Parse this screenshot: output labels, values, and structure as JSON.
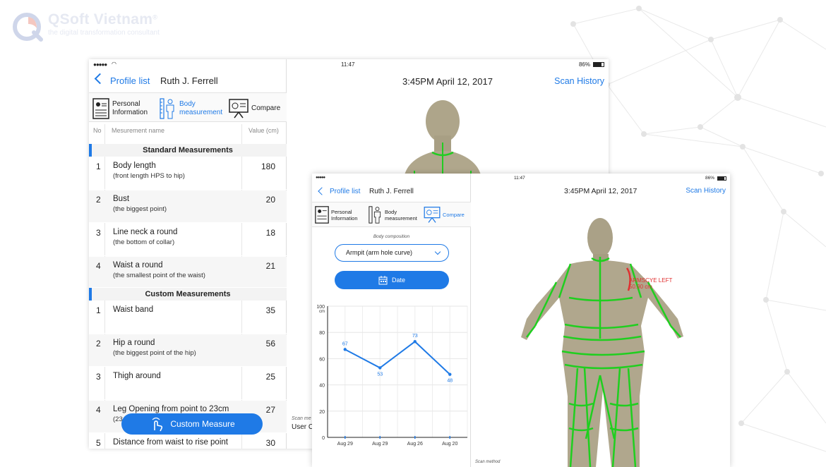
{
  "brand": {
    "name": "QSoft Vietnam",
    "registered": "®",
    "tagline": "the digital transformation consultant"
  },
  "colors": {
    "accent": "#1f7ae6",
    "body_green": "#1fcf1f",
    "label_red": "#e03030"
  },
  "back_tablet": {
    "status": {
      "signal": "●●●●●",
      "time": "11:47",
      "battery": "86%"
    },
    "nav": {
      "back_label": "Profile list",
      "name": "Ruth J. Ferrell"
    },
    "tabs": {
      "personal": "Personal Information",
      "body": "Body measurement",
      "compare": "Compare"
    },
    "columns": {
      "no": "No",
      "name": "Mesurement name",
      "value": "Value (cm)"
    },
    "standard_title": "Standard Measurements",
    "standard": [
      {
        "no": "1",
        "name": "Body length",
        "sub": "(front length HPS to hip)",
        "value": "180"
      },
      {
        "no": "2",
        "name": "Bust",
        "sub": "(the biggest point)",
        "value": "20"
      },
      {
        "no": "3",
        "name": "Line neck a round",
        "sub": "(the bottom of collar)",
        "value": "18"
      },
      {
        "no": "4",
        "name": "Waist a round",
        "sub": "(the smallest point of the waist)",
        "value": "21"
      }
    ],
    "custom_title": "Custom Measurements",
    "custom": [
      {
        "no": "1",
        "name": "Waist band",
        "sub": "",
        "value": "35"
      },
      {
        "no": "2",
        "name": "Hip a round",
        "sub": "(the biggest point of the hip)",
        "value": "56"
      },
      {
        "no": "3",
        "name": "Thigh around",
        "sub": "",
        "value": "25"
      },
      {
        "no": "4",
        "name": "Leg Opening from point to 23cm",
        "sub": "(23",
        "value": "27"
      },
      {
        "no": "5",
        "name": "Distance from waist to rise point",
        "sub": "",
        "value": "30"
      }
    ],
    "custom_measure_button": "Custom Measure",
    "scan_time": "3:45PM April 12, 2017",
    "scan_history": "Scan History",
    "scan_method": "Scan me",
    "user": "User C"
  },
  "front_tablet": {
    "status": {
      "signal": "●●●●●",
      "time": "11:47",
      "battery": "86%"
    },
    "nav": {
      "back_label": "Profile list",
      "name": "Ruth J. Ferrell"
    },
    "tabs": {
      "personal": "Personal Information",
      "body": "Body measurement",
      "compare": "Compare"
    },
    "body_composition_label": "Body composition",
    "select_value": "Armpit (arm hole curve)",
    "date_button": "Date",
    "scan_time": "3:45PM April 12, 2017",
    "scan_history": "Scan History",
    "scan_method": "Scan method",
    "model_label_1": "ARMSCYE LEFT",
    "model_label_2": "50.90 cm"
  },
  "chart_data": {
    "type": "line",
    "title": "",
    "xlabel": "",
    "ylabel": "cm",
    "ylim": [
      0,
      100
    ],
    "yticks": [
      0,
      20,
      40,
      60,
      80,
      100
    ],
    "categories": [
      "Aug 29",
      "Aug 29",
      "Aug 26",
      "Aug 20"
    ],
    "series": [
      {
        "values": [
          67,
          53,
          73,
          48
        ]
      }
    ],
    "grid": true,
    "color": "#1f7ae6"
  }
}
